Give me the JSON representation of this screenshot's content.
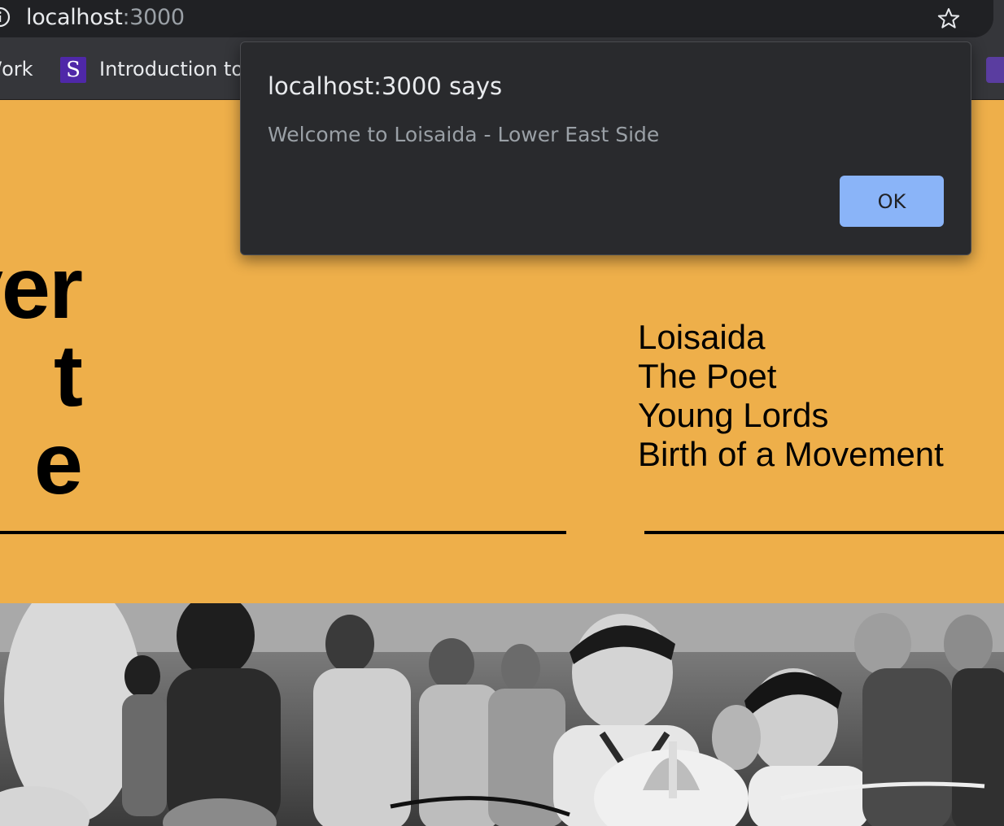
{
  "browser": {
    "url_host": "localhost",
    "url_port": ":3000",
    "bookmarks": [
      {
        "label": "/ork"
      },
      {
        "icon_letter": "S",
        "label": "Introduction to"
      }
    ]
  },
  "hero": {
    "title_lines": [
      "ver",
      "t",
      "e"
    ]
  },
  "nav": {
    "items": [
      "Loisaida",
      "The Poet",
      "Young Lords",
      "Birth of a Movement"
    ]
  },
  "dialog": {
    "title": "localhost:3000 says",
    "message": "Welcome to Loisaida - Lower East Side",
    "ok_label": "OK"
  },
  "colors": {
    "page_background": "#eeaf4a",
    "chrome_background": "#35363a",
    "omnibox_background": "#202124",
    "dialog_background": "#292a2d",
    "ok_button": "#8ab4f8"
  },
  "icons": {
    "info": "info-icon",
    "star": "star-icon"
  }
}
